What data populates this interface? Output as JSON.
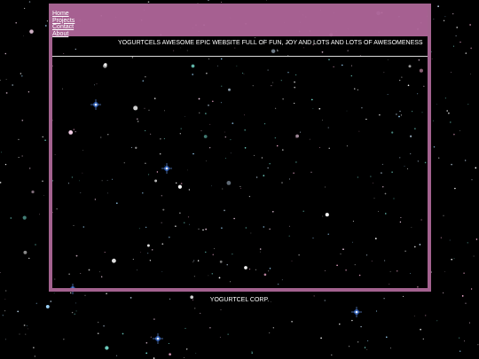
{
  "nav": {
    "items": [
      {
        "label": "Home"
      },
      {
        "label": "Projects"
      },
      {
        "label": "Contact"
      },
      {
        "label": "About"
      }
    ]
  },
  "header": {
    "title": "YOGURTCELS AWESOME EPIC WEBSITE FULL OF FUN, JOY AND LOTS AND LOTS OF AWESOMENESS"
  },
  "footer": {
    "text": "YOGURTCEL CORP."
  },
  "colors": {
    "frame": "#a3628f",
    "header_band": "#b0669a",
    "background": "#000000",
    "text": "#ffffff"
  }
}
